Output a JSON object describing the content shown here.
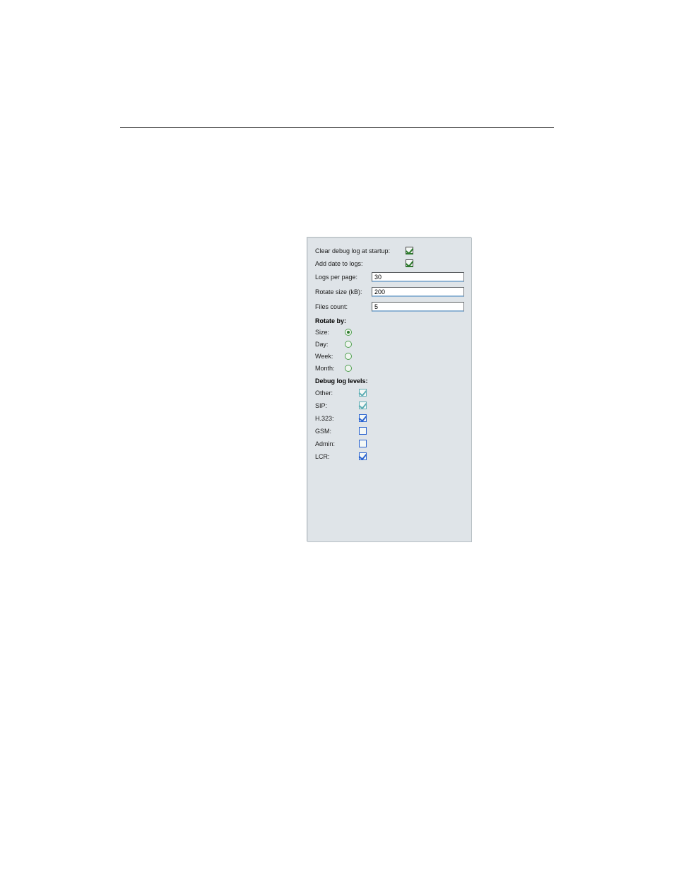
{
  "settings": {
    "clear_debug_label": "Clear debug log at startup:",
    "clear_debug_checked": true,
    "add_date_label": "Add date to logs:",
    "add_date_checked": true,
    "logs_per_page_label": "Logs per page:",
    "logs_per_page_value": "30",
    "rotate_size_label": "Rotate size (kB):",
    "rotate_size_value": "200",
    "files_count_label": "Files count:",
    "files_count_value": "5",
    "rotate_by_header": "Rotate by:",
    "rotate_options": [
      {
        "label": "Size:",
        "selected": true
      },
      {
        "label": "Day:",
        "selected": false
      },
      {
        "label": "Week:",
        "selected": false
      },
      {
        "label": "Month:",
        "selected": false
      }
    ],
    "debug_levels_header": "Debug log levels:",
    "debug_levels": [
      {
        "label": "Other:",
        "checked": true,
        "style": "teal"
      },
      {
        "label": "SIP:",
        "checked": true,
        "style": "teal"
      },
      {
        "label": "H.323:",
        "checked": true,
        "style": "blue"
      },
      {
        "label": "GSM:",
        "checked": false,
        "style": "blue"
      },
      {
        "label": "Admin:",
        "checked": false,
        "style": "blue"
      },
      {
        "label": "LCR:",
        "checked": true,
        "style": "blue"
      }
    ]
  }
}
